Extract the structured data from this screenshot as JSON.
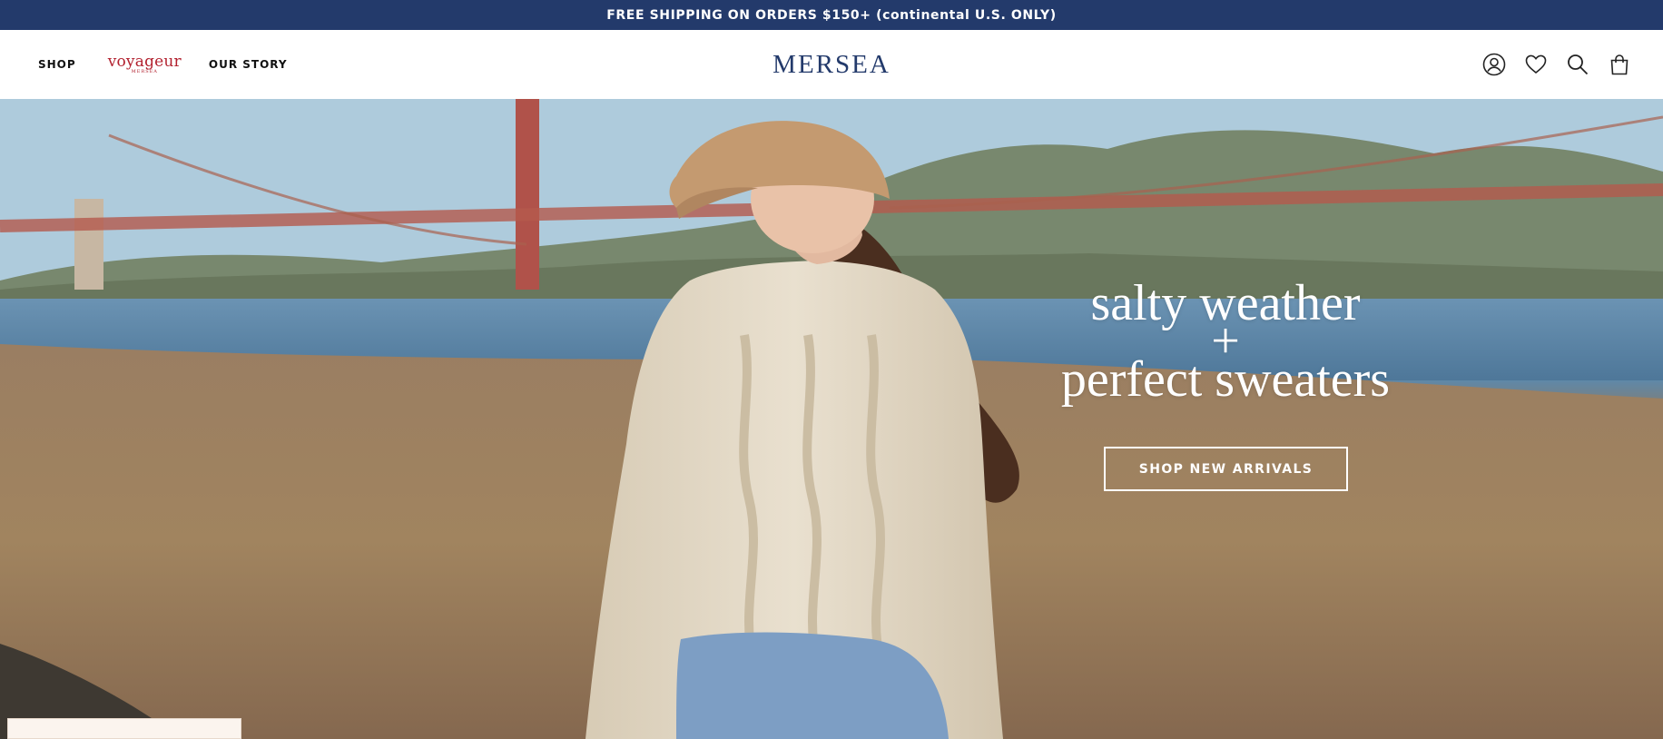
{
  "announcement": {
    "text": "FREE SHIPPING ON ORDERS $150+ (continental U.S. ONLY)"
  },
  "header": {
    "nav": {
      "shop_label": "SHOP",
      "voyageur_label": "voyageur",
      "voyageur_sub": "MERSEA",
      "our_story_label": "OUR STORY"
    },
    "logo": "MERSEA",
    "icons": [
      "account-icon",
      "heart-icon",
      "search-icon",
      "bag-icon"
    ]
  },
  "hero": {
    "headline_line1": "salty weather",
    "headline_line2": "+",
    "headline_line3": "perfect sweaters",
    "cta_label": "SHOP NEW ARRIVALS"
  },
  "colors": {
    "navy": "#233a6b",
    "voyageur_red": "#b2202e",
    "white": "#ffffff"
  }
}
